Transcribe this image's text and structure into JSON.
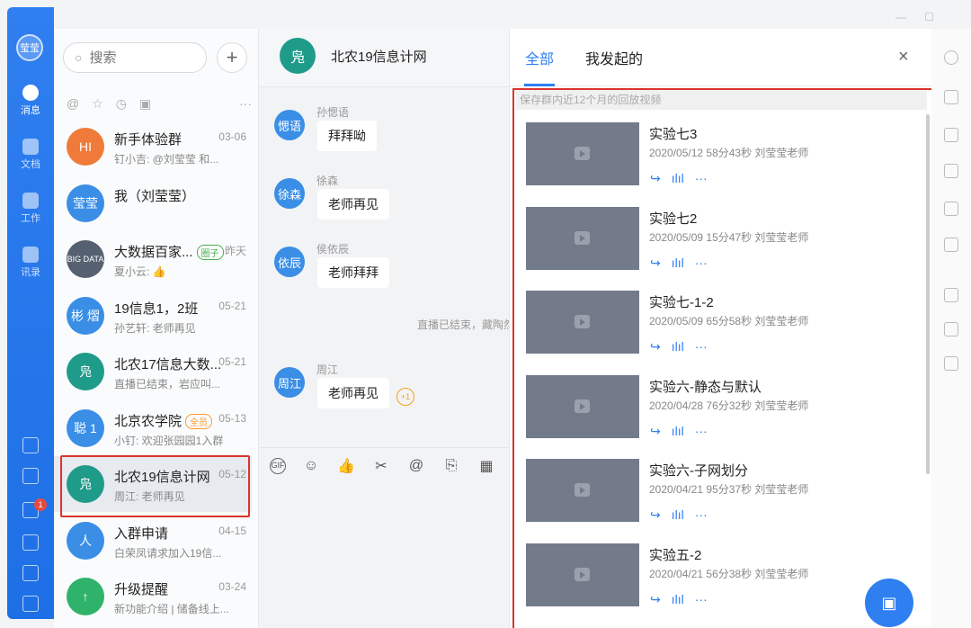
{
  "rail": {
    "avatar_label": "莹莹",
    "items": [
      {
        "label": "消息",
        "icon": "message-icon"
      },
      {
        "label": "文档",
        "icon": "document-icon"
      },
      {
        "label": "工作",
        "icon": "work-icon"
      },
      {
        "label": "讯录",
        "icon": "contacts-icon"
      }
    ],
    "badge": "1"
  },
  "conversations": {
    "search_placeholder": "搜索",
    "add": "+",
    "filters": [
      "@",
      "☆",
      "◷",
      "▣",
      "···"
    ],
    "items": [
      {
        "name": "新手体验群",
        "date": "03-06",
        "sub": "钉小吉: @刘莹莹 和...",
        "avatar": "HI",
        "color": "#f07a3a"
      },
      {
        "name": "我（刘莹莹）",
        "date": "",
        "sub": "",
        "avatar": "莹莹",
        "color": "#3a8ee6"
      },
      {
        "name": "大数据百家...",
        "tag": "圈子",
        "date": "昨天",
        "sub": "夏小云: 👍",
        "avatar": "BIG DATA",
        "color": "#556070"
      },
      {
        "name": "19信息1，2班",
        "date": "05-21",
        "sub": "孙艺轩: 老师再见",
        "avatar": "彬 熠",
        "color": "#3a8ee6"
      },
      {
        "name": "北农17信息大数...",
        "date": "05-21",
        "sub": "直播已结束，岩应叫...",
        "avatar": "凫",
        "color": "#1f9b8a"
      },
      {
        "name": "北京农学院",
        "tag": "全员",
        "date": "05-13",
        "sub": "小钉: 欢迎张园园1入群",
        "avatar": "聪 1",
        "color": "#3a8ee6"
      },
      {
        "name": "北农19信息计网",
        "date": "05-12",
        "sub": "周江: 老师再见",
        "avatar": "凫",
        "color": "#1f9b8a"
      },
      {
        "name": "入群申请",
        "date": "04-15",
        "sub": "白荣凤请求加入19信...",
        "avatar": "人",
        "color": "#3a8ee6"
      },
      {
        "name": "升级提醒",
        "date": "03-24",
        "sub": "新功能介绍 | 储备线上...",
        "avatar": "↑",
        "color": "#2fb36a"
      }
    ]
  },
  "chat": {
    "title": "北农19信息计网",
    "avatar": "凫",
    "messages": [
      {
        "avatar": "愢语",
        "sender": "孙愢语",
        "text": "拜拜呦"
      },
      {
        "avatar": "徐森",
        "sender": "徐森",
        "text": "老师再见"
      },
      {
        "avatar": "依辰",
        "sender": "侯依辰",
        "text": "老师拜拜"
      },
      {
        "avatar": "周江",
        "sender": "周江",
        "text": "老师再见"
      }
    ],
    "system_note": "直播已结束，藏陶然",
    "plus_one": "+1",
    "toolbar": [
      "GIF",
      "☺",
      "👍",
      "✂",
      "@",
      "⎘",
      "▦"
    ]
  },
  "panel": {
    "tabs": [
      "全部",
      "我发起的"
    ],
    "active_tab": "全部",
    "close": "×",
    "notice": "保存群内近12个月的回放视频",
    "videos": [
      {
        "title": "实验七3",
        "meta": "2020/05/12 58分43秒 刘莹莹老师"
      },
      {
        "title": "实验七2",
        "meta": "2020/05/09 15分47秒 刘莹莹老师"
      },
      {
        "title": "实验七-1-2",
        "meta": "2020/05/09 65分58秒 刘莹莹老师"
      },
      {
        "title": "实验六-静态与默认",
        "meta": "2020/04/28 76分32秒 刘莹莹老师"
      },
      {
        "title": "实验六-子网划分",
        "meta": "2020/04/21 95分37秒 刘莹莹老师"
      },
      {
        "title": "实验五-2",
        "meta": "2020/04/21 56分38秒 刘莹莹老师"
      }
    ],
    "actions": [
      "↪",
      "ılıl",
      "···"
    ],
    "fab": "▣"
  },
  "colors": {
    "accent": "#2f7ff0",
    "highlight": "#d9342c"
  }
}
